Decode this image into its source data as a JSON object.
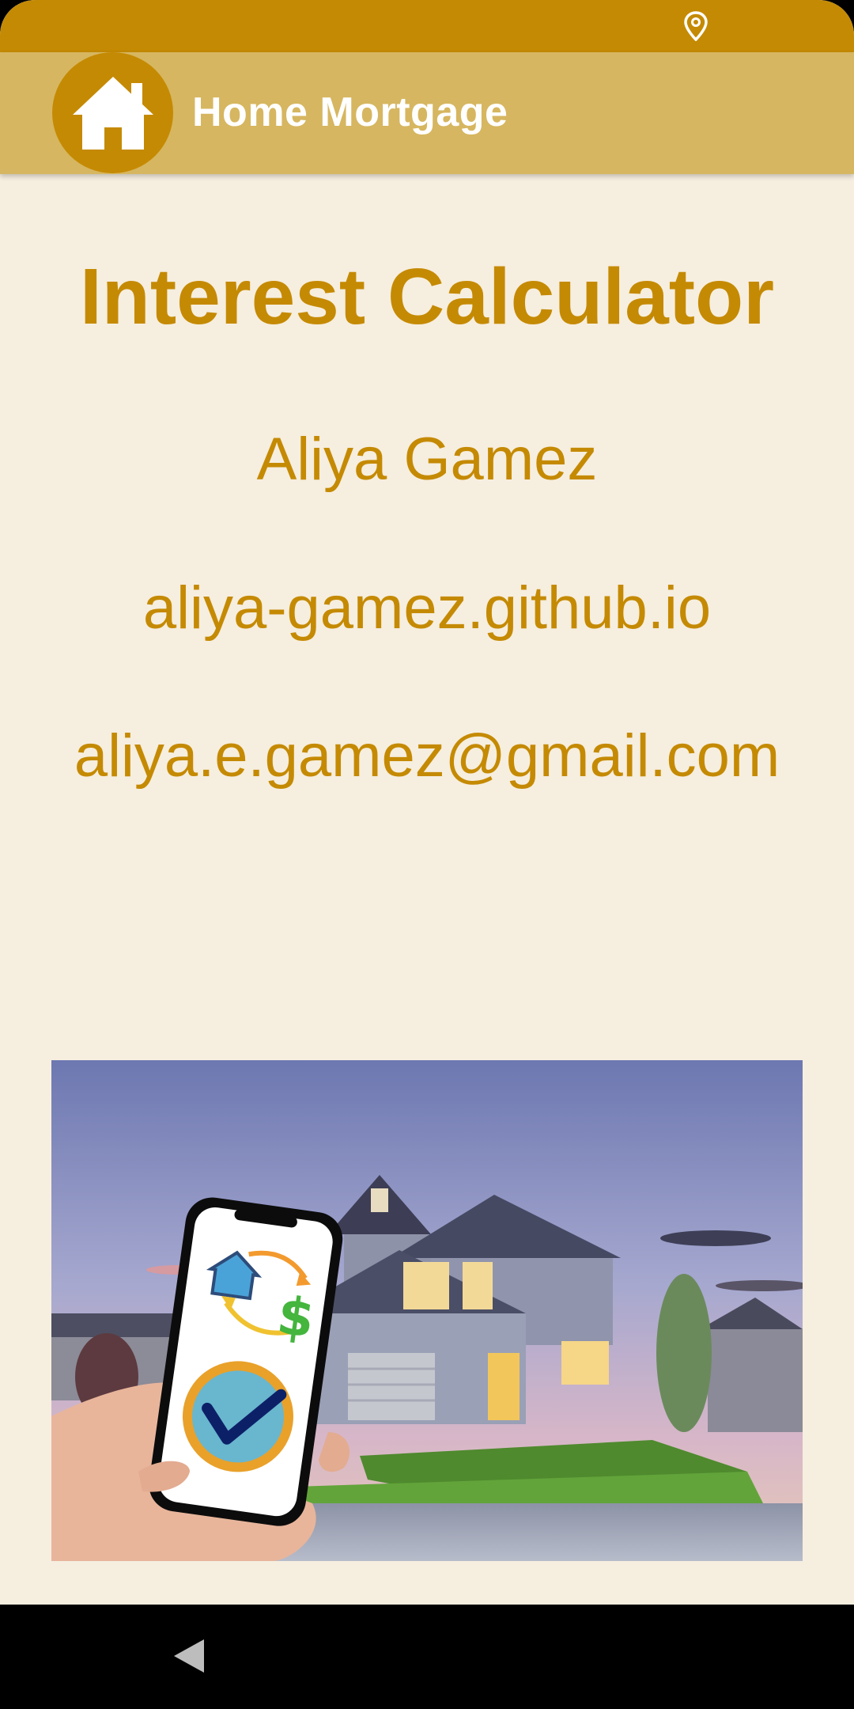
{
  "status_bar": {
    "icon": "location-pin-icon",
    "color": "#c58a03"
  },
  "app_bar": {
    "title": "Home Mortgage",
    "logo_icon": "house-icon",
    "background": "#d6b660"
  },
  "content": {
    "title": "Interest Calculator",
    "author_name": "Aliya Gamez",
    "website": "aliya-gamez.github.io",
    "email": "aliya.e.gamez@gmail.com",
    "text_color": "#c58a03",
    "background": "#f6eedf"
  },
  "hero_image": {
    "subject": "house-at-dusk-with-phone-mortgage-app",
    "phone_icons": [
      "house-icon",
      "dollar-icon",
      "checkmark-icon"
    ]
  },
  "nav_bar": {
    "back_icon": "back-triangle-icon"
  }
}
